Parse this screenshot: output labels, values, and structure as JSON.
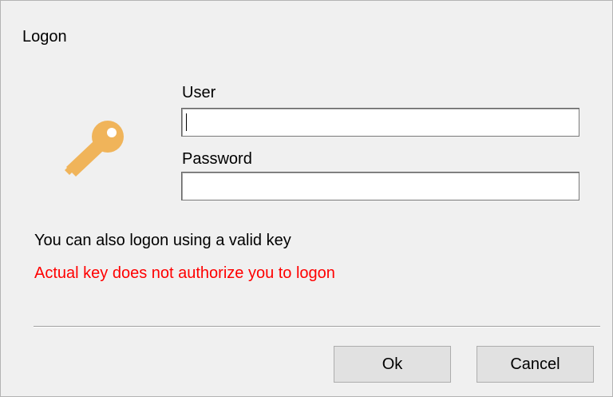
{
  "window": {
    "title": "Logon"
  },
  "form": {
    "user_label": "User",
    "user_value": "",
    "password_label": "Password",
    "password_value": ""
  },
  "messages": {
    "info": "You can also logon using a valid key",
    "error": "Actual key does not authorize you to logon",
    "error_color": "#ff0000"
  },
  "icons": {
    "key": "key-icon",
    "key_color": "#f0b45a"
  },
  "buttons": {
    "ok_label": "Ok",
    "cancel_label": "Cancel"
  }
}
